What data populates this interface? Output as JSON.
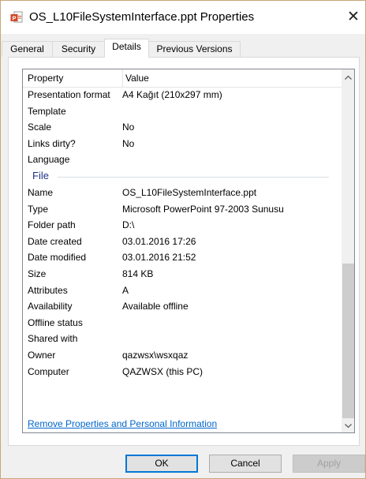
{
  "window": {
    "title": "OS_L10FileSystemInterface.ppt Properties",
    "title_icon": "powerpoint-file-icon",
    "close_glyph": "✕"
  },
  "tabs": [
    {
      "label": "General",
      "active": false
    },
    {
      "label": "Security",
      "active": false
    },
    {
      "label": "Details",
      "active": true
    },
    {
      "label": "Previous Versions",
      "active": false
    }
  ],
  "columns": {
    "property": "Property",
    "value": "Value"
  },
  "rows_top": [
    {
      "key": "Presentation format",
      "value": "A4 Kağıt (210x297 mm)"
    },
    {
      "key": "Template",
      "value": ""
    },
    {
      "key": "Scale",
      "value": "No"
    },
    {
      "key": "Links dirty?",
      "value": "No"
    },
    {
      "key": "Language",
      "value": ""
    }
  ],
  "group_file": "File",
  "rows_file": [
    {
      "key": "Name",
      "value": "OS_L10FileSystemInterface.ppt"
    },
    {
      "key": "Type",
      "value": "Microsoft PowerPoint 97-2003 Sunusu"
    },
    {
      "key": "Folder path",
      "value": "D:\\"
    },
    {
      "key": "Date created",
      "value": "03.01.2016 17:26"
    },
    {
      "key": "Date modified",
      "value": "03.01.2016 21:52"
    },
    {
      "key": "Size",
      "value": "814 KB"
    },
    {
      "key": "Attributes",
      "value": "A"
    },
    {
      "key": "Availability",
      "value": "Available offline"
    },
    {
      "key": "Offline status",
      "value": ""
    },
    {
      "key": "Shared with",
      "value": ""
    },
    {
      "key": "Owner",
      "value": "qazwsx\\wsxqaz"
    },
    {
      "key": "Computer",
      "value": "QAZWSX (this PC)"
    }
  ],
  "scrollbar": {
    "up_glyph": "⌃",
    "down_glyph": "⌄"
  },
  "remove_link": "Remove Properties and Personal Information",
  "buttons": {
    "ok": "OK",
    "cancel": "Cancel",
    "apply": "Apply"
  },
  "colors": {
    "link": "#0066cc",
    "group_label": "#1e3287",
    "default_button_border": "#0078d7"
  }
}
